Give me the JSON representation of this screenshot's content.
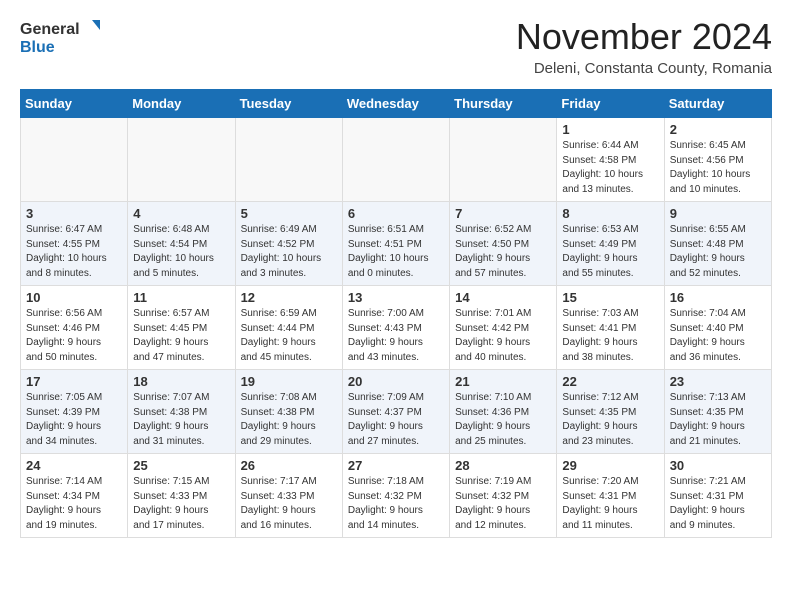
{
  "header": {
    "logo_general": "General",
    "logo_blue": "Blue",
    "title": "November 2024",
    "location": "Deleni, Constanta County, Romania"
  },
  "days_of_week": [
    "Sunday",
    "Monday",
    "Tuesday",
    "Wednesday",
    "Thursday",
    "Friday",
    "Saturday"
  ],
  "weeks": [
    [
      {
        "day": "",
        "info": "",
        "empty": true
      },
      {
        "day": "",
        "info": "",
        "empty": true
      },
      {
        "day": "",
        "info": "",
        "empty": true
      },
      {
        "day": "",
        "info": "",
        "empty": true
      },
      {
        "day": "",
        "info": "",
        "empty": true
      },
      {
        "day": "1",
        "info": "Sunrise: 6:44 AM\nSunset: 4:58 PM\nDaylight: 10 hours\nand 13 minutes."
      },
      {
        "day": "2",
        "info": "Sunrise: 6:45 AM\nSunset: 4:56 PM\nDaylight: 10 hours\nand 10 minutes."
      }
    ],
    [
      {
        "day": "3",
        "info": "Sunrise: 6:47 AM\nSunset: 4:55 PM\nDaylight: 10 hours\nand 8 minutes."
      },
      {
        "day": "4",
        "info": "Sunrise: 6:48 AM\nSunset: 4:54 PM\nDaylight: 10 hours\nand 5 minutes."
      },
      {
        "day": "5",
        "info": "Sunrise: 6:49 AM\nSunset: 4:52 PM\nDaylight: 10 hours\nand 3 minutes."
      },
      {
        "day": "6",
        "info": "Sunrise: 6:51 AM\nSunset: 4:51 PM\nDaylight: 10 hours\nand 0 minutes."
      },
      {
        "day": "7",
        "info": "Sunrise: 6:52 AM\nSunset: 4:50 PM\nDaylight: 9 hours\nand 57 minutes."
      },
      {
        "day": "8",
        "info": "Sunrise: 6:53 AM\nSunset: 4:49 PM\nDaylight: 9 hours\nand 55 minutes."
      },
      {
        "day": "9",
        "info": "Sunrise: 6:55 AM\nSunset: 4:48 PM\nDaylight: 9 hours\nand 52 minutes."
      }
    ],
    [
      {
        "day": "10",
        "info": "Sunrise: 6:56 AM\nSunset: 4:46 PM\nDaylight: 9 hours\nand 50 minutes."
      },
      {
        "day": "11",
        "info": "Sunrise: 6:57 AM\nSunset: 4:45 PM\nDaylight: 9 hours\nand 47 minutes."
      },
      {
        "day": "12",
        "info": "Sunrise: 6:59 AM\nSunset: 4:44 PM\nDaylight: 9 hours\nand 45 minutes."
      },
      {
        "day": "13",
        "info": "Sunrise: 7:00 AM\nSunset: 4:43 PM\nDaylight: 9 hours\nand 43 minutes."
      },
      {
        "day": "14",
        "info": "Sunrise: 7:01 AM\nSunset: 4:42 PM\nDaylight: 9 hours\nand 40 minutes."
      },
      {
        "day": "15",
        "info": "Sunrise: 7:03 AM\nSunset: 4:41 PM\nDaylight: 9 hours\nand 38 minutes."
      },
      {
        "day": "16",
        "info": "Sunrise: 7:04 AM\nSunset: 4:40 PM\nDaylight: 9 hours\nand 36 minutes."
      }
    ],
    [
      {
        "day": "17",
        "info": "Sunrise: 7:05 AM\nSunset: 4:39 PM\nDaylight: 9 hours\nand 34 minutes."
      },
      {
        "day": "18",
        "info": "Sunrise: 7:07 AM\nSunset: 4:38 PM\nDaylight: 9 hours\nand 31 minutes."
      },
      {
        "day": "19",
        "info": "Sunrise: 7:08 AM\nSunset: 4:38 PM\nDaylight: 9 hours\nand 29 minutes."
      },
      {
        "day": "20",
        "info": "Sunrise: 7:09 AM\nSunset: 4:37 PM\nDaylight: 9 hours\nand 27 minutes."
      },
      {
        "day": "21",
        "info": "Sunrise: 7:10 AM\nSunset: 4:36 PM\nDaylight: 9 hours\nand 25 minutes."
      },
      {
        "day": "22",
        "info": "Sunrise: 7:12 AM\nSunset: 4:35 PM\nDaylight: 9 hours\nand 23 minutes."
      },
      {
        "day": "23",
        "info": "Sunrise: 7:13 AM\nSunset: 4:35 PM\nDaylight: 9 hours\nand 21 minutes."
      }
    ],
    [
      {
        "day": "24",
        "info": "Sunrise: 7:14 AM\nSunset: 4:34 PM\nDaylight: 9 hours\nand 19 minutes."
      },
      {
        "day": "25",
        "info": "Sunrise: 7:15 AM\nSunset: 4:33 PM\nDaylight: 9 hours\nand 17 minutes."
      },
      {
        "day": "26",
        "info": "Sunrise: 7:17 AM\nSunset: 4:33 PM\nDaylight: 9 hours\nand 16 minutes."
      },
      {
        "day": "27",
        "info": "Sunrise: 7:18 AM\nSunset: 4:32 PM\nDaylight: 9 hours\nand 14 minutes."
      },
      {
        "day": "28",
        "info": "Sunrise: 7:19 AM\nSunset: 4:32 PM\nDaylight: 9 hours\nand 12 minutes."
      },
      {
        "day": "29",
        "info": "Sunrise: 7:20 AM\nSunset: 4:31 PM\nDaylight: 9 hours\nand 11 minutes."
      },
      {
        "day": "30",
        "info": "Sunrise: 7:21 AM\nSunset: 4:31 PM\nDaylight: 9 hours\nand 9 minutes."
      }
    ]
  ],
  "alt_rows": [
    1,
    3
  ]
}
